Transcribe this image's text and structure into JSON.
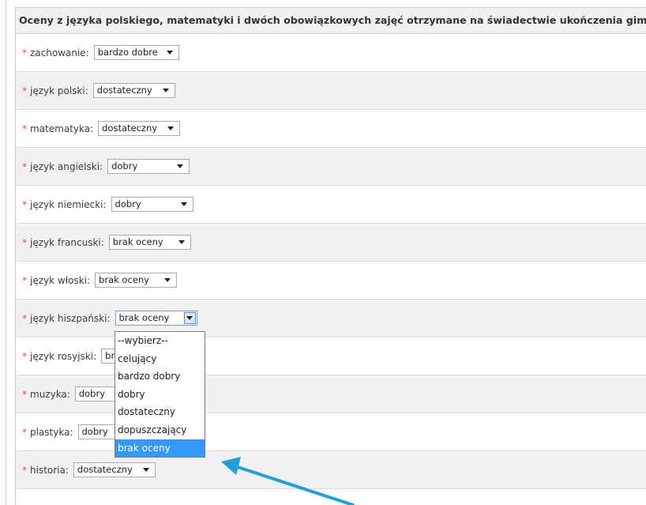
{
  "form": {
    "header": "Oceny z języka polskiego, matematyki i dwóch obowiązkowych zajęć otrzymane na świadectwie ukończenia gimnazjum:",
    "required_mark": "*",
    "rows": [
      {
        "label": "zachowanie:",
        "value": "bardzo dobre",
        "open": false
      },
      {
        "label": "język polski:",
        "value": "dostateczny",
        "open": false
      },
      {
        "label": "matematyka:",
        "value": "dostateczny",
        "open": false
      },
      {
        "label": "język angielski:",
        "value": "dobry",
        "open": false
      },
      {
        "label": "język niemiecki:",
        "value": "dobry",
        "open": false
      },
      {
        "label": "język francuski:",
        "value": "brak oceny",
        "open": false
      },
      {
        "label": "język włoski:",
        "value": "brak oceny",
        "open": false
      },
      {
        "label": "język hiszpański:",
        "value": "brak oceny",
        "open": true
      },
      {
        "label": "język rosyjski:",
        "value": "brak oceny",
        "open": false
      },
      {
        "label": "muzyka:",
        "value": "dobry",
        "open": false
      },
      {
        "label": "plastyka:",
        "value": "dobry",
        "open": false
      },
      {
        "label": "historia:",
        "value": "dostateczny",
        "open": false
      }
    ]
  },
  "dropdown": {
    "options": [
      "--wybierz--",
      "celujący",
      "bardzo dobry",
      "dobry",
      "dostateczny",
      "dopuszczający",
      "brak oceny"
    ],
    "selected": "brak oceny"
  },
  "colors": {
    "required": "#e64a3b",
    "selected_option": "#3399ff",
    "annotation_arrow": "#1ea0dc"
  }
}
